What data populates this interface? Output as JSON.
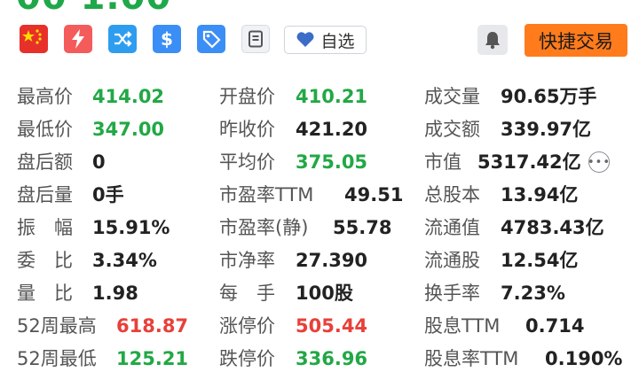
{
  "header": {
    "price_partial": "00 1.00"
  },
  "toolbar": {
    "favorite_label": "自选",
    "trade_label": "快捷交易"
  },
  "colors": {
    "up": "#e8403a",
    "down": "#22a845",
    "trade_button": "#ff7b1c"
  },
  "stats": {
    "col1": [
      {
        "label": "最高价",
        "value": "414.02"
      },
      {
        "label": "最低价",
        "value": "347.00"
      },
      {
        "label": "盘后额",
        "value": "0"
      },
      {
        "label": "盘后量",
        "value": "0手"
      },
      {
        "label": "振　幅",
        "value": "15.91%"
      },
      {
        "label": "委　比",
        "value": "3.34%"
      },
      {
        "label": "量　比",
        "value": "1.98"
      },
      {
        "label": "52周最高",
        "value": "618.87"
      },
      {
        "label": "52周最低",
        "value": "125.21"
      }
    ],
    "col2": [
      {
        "label": "开盘价",
        "value": "410.21"
      },
      {
        "label": "昨收价",
        "value": "421.20"
      },
      {
        "label": "平均价",
        "value": "375.05"
      },
      {
        "label": "市盈率TTM",
        "value": "49.51"
      },
      {
        "label": "市盈率(静)",
        "value": "55.78"
      },
      {
        "label": "市净率",
        "value": "27.390"
      },
      {
        "label": "每　手",
        "value": "100股"
      },
      {
        "label": "涨停价",
        "value": "505.44"
      },
      {
        "label": "跌停价",
        "value": "336.96"
      }
    ],
    "col3": [
      {
        "label": "成交量",
        "value": "90.65万手"
      },
      {
        "label": "成交额",
        "value": "339.97亿"
      },
      {
        "label": "市值",
        "value": "5317.42亿"
      },
      {
        "label": "总股本",
        "value": "13.94亿"
      },
      {
        "label": "流通值",
        "value": "4783.43亿"
      },
      {
        "label": "流通股",
        "value": "12.54亿"
      },
      {
        "label": "换手率",
        "value": "7.23%"
      },
      {
        "label": "股息TTM",
        "value": "0.714"
      },
      {
        "label": "股息率TTM",
        "value": "0.190%"
      }
    ]
  }
}
